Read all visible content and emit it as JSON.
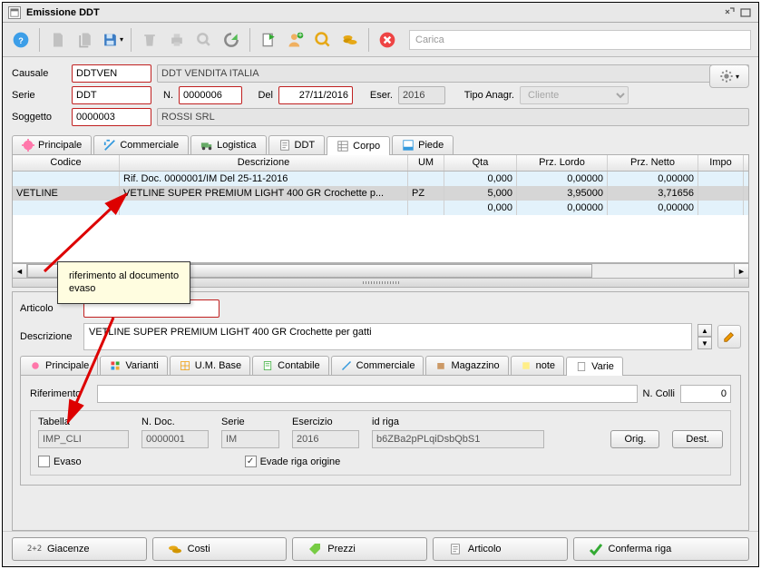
{
  "window": {
    "title": "Emissione DDT"
  },
  "toolbar": {
    "search_placeholder": "Carica"
  },
  "header": {
    "labels": {
      "causale": "Causale",
      "serie": "Serie",
      "n": "N.",
      "del": "Del",
      "eser": "Eser.",
      "tipo_anagr": "Tipo Anagr.",
      "soggetto": "Soggetto"
    },
    "causale": "DDTVEN",
    "causale_descr": "DDT VENDITA ITALIA",
    "serie": "DDT",
    "numero": "0000006",
    "del": "27/11/2016",
    "eser": "2016",
    "tipo_anagr": "Cliente",
    "soggetto": "0000003",
    "soggetto_descr": "ROSSI SRL"
  },
  "tabs": [
    "Principale",
    "Commerciale",
    "Logistica",
    "DDT",
    "Corpo",
    "Piede"
  ],
  "grid": {
    "cols": [
      "Codice",
      "Descrizione",
      "UM",
      "Qta",
      "Prz. Lordo",
      "Prz. Netto",
      "Impo"
    ],
    "rows": [
      {
        "codice": "",
        "descr": "Rif. Doc. 0000001/IM Del 25-11-2016",
        "um": "",
        "qta": "0,000",
        "prl": "0,00000",
        "prn": "0,00000"
      },
      {
        "codice": "VETLINE",
        "descr": "VETLINE SUPER PREMIUM LIGHT 400 GR Crochette p...",
        "um": "PZ",
        "qta": "5,000",
        "prl": "3,95000",
        "prn": "3,71656"
      },
      {
        "codice": "",
        "descr": "",
        "um": "",
        "qta": "0,000",
        "prl": "0,00000",
        "prn": "0,00000"
      }
    ]
  },
  "annotation": {
    "line1": "riferimento al documento",
    "line2": "evaso"
  },
  "detail": {
    "labels": {
      "articolo": "Articolo",
      "descrizione": "Descrizione",
      "riferimento": "Riferimento",
      "ncolli": "N. Colli"
    },
    "descrizione": "VETLINE SUPER PREMIUM LIGHT 400 GR Crochette per gatti",
    "riferimento": "",
    "ncolli": "0",
    "dtabs": [
      "Principale",
      "Varianti",
      "U.M. Base",
      "Contabile",
      "Commerciale",
      "Magazzino",
      "note",
      "Varie"
    ],
    "origin": {
      "labels": {
        "tabella": "Tabella",
        "ndoc": "N. Doc.",
        "serie": "Serie",
        "esercizio": "Esercizio",
        "idriga": "id riga",
        "evaso": "Evaso",
        "evade": "Evade riga origine",
        "orig": "Orig.",
        "dest": "Dest."
      },
      "tabella": "IMP_CLI",
      "ndoc": "0000001",
      "serie": "IM",
      "esercizio": "2016",
      "idriga": "b6ZBa2pPLqiDsbQbS1",
      "evaso": false,
      "evade": true
    }
  },
  "footer": {
    "giacenze": "Giacenze",
    "costi": "Costi",
    "prezzi": "Prezzi",
    "articolo": "Articolo",
    "conferma": "Conferma riga",
    "g_prefix": "2+2"
  }
}
